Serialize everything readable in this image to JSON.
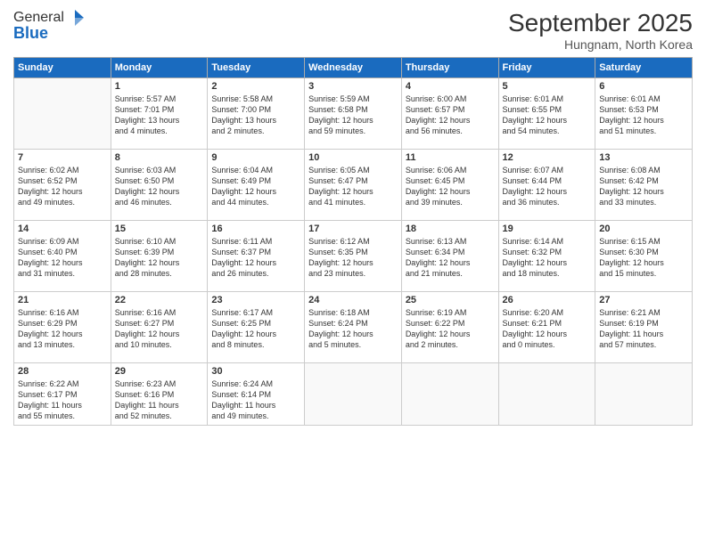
{
  "header": {
    "logo_line1": "General",
    "logo_line2": "Blue",
    "month": "September 2025",
    "location": "Hungnam, North Korea"
  },
  "days_of_week": [
    "Sunday",
    "Monday",
    "Tuesday",
    "Wednesday",
    "Thursday",
    "Friday",
    "Saturday"
  ],
  "weeks": [
    [
      {
        "day": "",
        "info": ""
      },
      {
        "day": "1",
        "info": "Sunrise: 5:57 AM\nSunset: 7:01 PM\nDaylight: 13 hours\nand 4 minutes."
      },
      {
        "day": "2",
        "info": "Sunrise: 5:58 AM\nSunset: 7:00 PM\nDaylight: 13 hours\nand 2 minutes."
      },
      {
        "day": "3",
        "info": "Sunrise: 5:59 AM\nSunset: 6:58 PM\nDaylight: 12 hours\nand 59 minutes."
      },
      {
        "day": "4",
        "info": "Sunrise: 6:00 AM\nSunset: 6:57 PM\nDaylight: 12 hours\nand 56 minutes."
      },
      {
        "day": "5",
        "info": "Sunrise: 6:01 AM\nSunset: 6:55 PM\nDaylight: 12 hours\nand 54 minutes."
      },
      {
        "day": "6",
        "info": "Sunrise: 6:01 AM\nSunset: 6:53 PM\nDaylight: 12 hours\nand 51 minutes."
      }
    ],
    [
      {
        "day": "7",
        "info": "Sunrise: 6:02 AM\nSunset: 6:52 PM\nDaylight: 12 hours\nand 49 minutes."
      },
      {
        "day": "8",
        "info": "Sunrise: 6:03 AM\nSunset: 6:50 PM\nDaylight: 12 hours\nand 46 minutes."
      },
      {
        "day": "9",
        "info": "Sunrise: 6:04 AM\nSunset: 6:49 PM\nDaylight: 12 hours\nand 44 minutes."
      },
      {
        "day": "10",
        "info": "Sunrise: 6:05 AM\nSunset: 6:47 PM\nDaylight: 12 hours\nand 41 minutes."
      },
      {
        "day": "11",
        "info": "Sunrise: 6:06 AM\nSunset: 6:45 PM\nDaylight: 12 hours\nand 39 minutes."
      },
      {
        "day": "12",
        "info": "Sunrise: 6:07 AM\nSunset: 6:44 PM\nDaylight: 12 hours\nand 36 minutes."
      },
      {
        "day": "13",
        "info": "Sunrise: 6:08 AM\nSunset: 6:42 PM\nDaylight: 12 hours\nand 33 minutes."
      }
    ],
    [
      {
        "day": "14",
        "info": "Sunrise: 6:09 AM\nSunset: 6:40 PM\nDaylight: 12 hours\nand 31 minutes."
      },
      {
        "day": "15",
        "info": "Sunrise: 6:10 AM\nSunset: 6:39 PM\nDaylight: 12 hours\nand 28 minutes."
      },
      {
        "day": "16",
        "info": "Sunrise: 6:11 AM\nSunset: 6:37 PM\nDaylight: 12 hours\nand 26 minutes."
      },
      {
        "day": "17",
        "info": "Sunrise: 6:12 AM\nSunset: 6:35 PM\nDaylight: 12 hours\nand 23 minutes."
      },
      {
        "day": "18",
        "info": "Sunrise: 6:13 AM\nSunset: 6:34 PM\nDaylight: 12 hours\nand 21 minutes."
      },
      {
        "day": "19",
        "info": "Sunrise: 6:14 AM\nSunset: 6:32 PM\nDaylight: 12 hours\nand 18 minutes."
      },
      {
        "day": "20",
        "info": "Sunrise: 6:15 AM\nSunset: 6:30 PM\nDaylight: 12 hours\nand 15 minutes."
      }
    ],
    [
      {
        "day": "21",
        "info": "Sunrise: 6:16 AM\nSunset: 6:29 PM\nDaylight: 12 hours\nand 13 minutes."
      },
      {
        "day": "22",
        "info": "Sunrise: 6:16 AM\nSunset: 6:27 PM\nDaylight: 12 hours\nand 10 minutes."
      },
      {
        "day": "23",
        "info": "Sunrise: 6:17 AM\nSunset: 6:25 PM\nDaylight: 12 hours\nand 8 minutes."
      },
      {
        "day": "24",
        "info": "Sunrise: 6:18 AM\nSunset: 6:24 PM\nDaylight: 12 hours\nand 5 minutes."
      },
      {
        "day": "25",
        "info": "Sunrise: 6:19 AM\nSunset: 6:22 PM\nDaylight: 12 hours\nand 2 minutes."
      },
      {
        "day": "26",
        "info": "Sunrise: 6:20 AM\nSunset: 6:21 PM\nDaylight: 12 hours\nand 0 minutes."
      },
      {
        "day": "27",
        "info": "Sunrise: 6:21 AM\nSunset: 6:19 PM\nDaylight: 11 hours\nand 57 minutes."
      }
    ],
    [
      {
        "day": "28",
        "info": "Sunrise: 6:22 AM\nSunset: 6:17 PM\nDaylight: 11 hours\nand 55 minutes."
      },
      {
        "day": "29",
        "info": "Sunrise: 6:23 AM\nSunset: 6:16 PM\nDaylight: 11 hours\nand 52 minutes."
      },
      {
        "day": "30",
        "info": "Sunrise: 6:24 AM\nSunset: 6:14 PM\nDaylight: 11 hours\nand 49 minutes."
      },
      {
        "day": "",
        "info": ""
      },
      {
        "day": "",
        "info": ""
      },
      {
        "day": "",
        "info": ""
      },
      {
        "day": "",
        "info": ""
      }
    ]
  ]
}
